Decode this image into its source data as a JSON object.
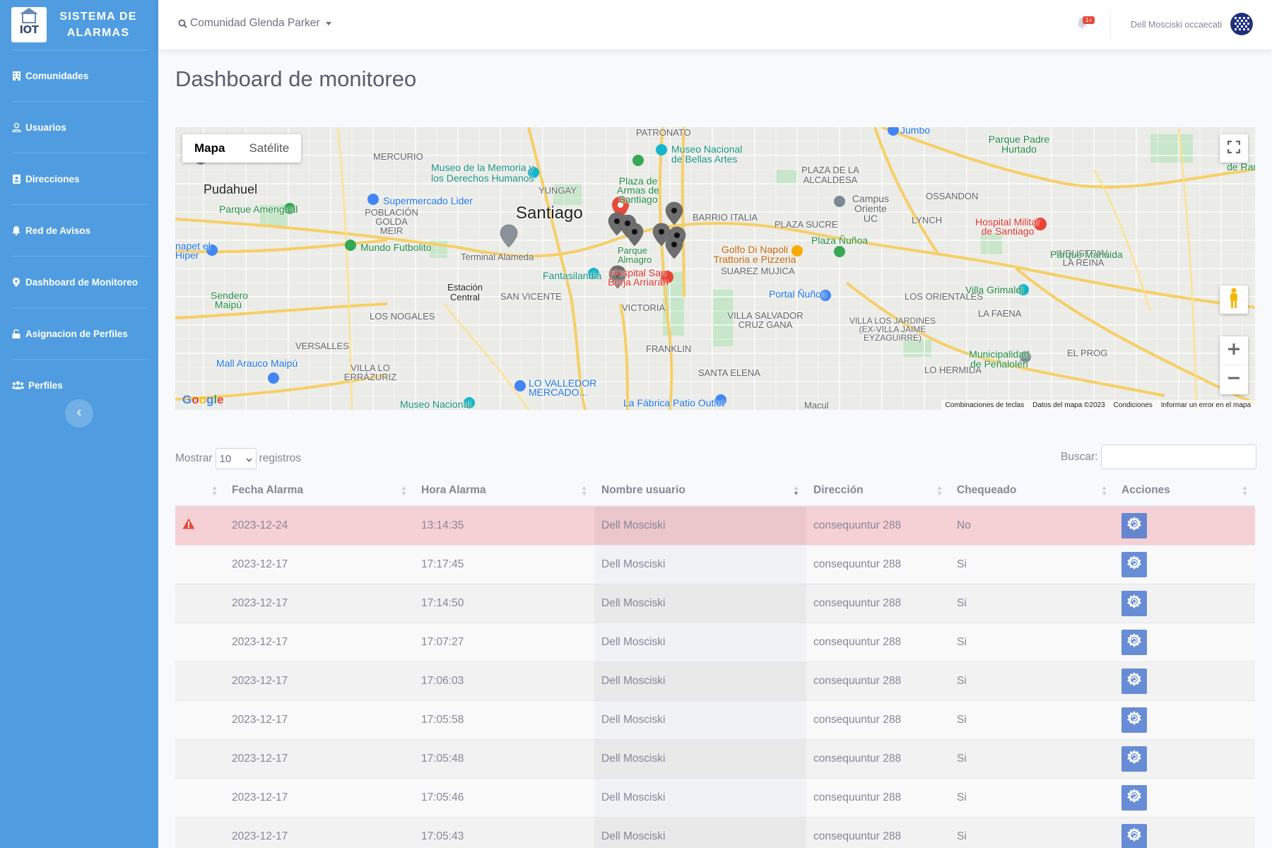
{
  "brand": {
    "logo_text": "IOT",
    "title": "SISTEMA DE ALARMAS"
  },
  "sidebar": {
    "items": [
      {
        "label": "Comunidades",
        "icon": "building-icon"
      },
      {
        "label": "Usuarios",
        "icon": "user-icon"
      },
      {
        "label": "Direcciones",
        "icon": "address-card-icon"
      },
      {
        "label": "Red de Avisos",
        "icon": "bell-icon"
      },
      {
        "label": "Dashboard de Monitoreo",
        "icon": "map-marker-icon"
      },
      {
        "label": "Asignacion de Perfiles",
        "icon": "unlock-icon"
      },
      {
        "label": "Perfiles",
        "icon": "users-icon"
      }
    ]
  },
  "topbar": {
    "community": "Comunidad Glenda Parker",
    "alerts_badge": "1+",
    "user_name": "Dell Mosciski occaecati"
  },
  "page": {
    "title": "Dashboard de monitoreo"
  },
  "map": {
    "type_map": "Mapa",
    "type_satellite": "Satélite",
    "provider": "Google",
    "labels": {
      "santiago": "Santiago",
      "pudahuel": "Pudahuel",
      "mercurio": "MERCURIO",
      "poblacion": "POBLACIÓN GOLDA MEIR",
      "yungay": "YUNGAY",
      "barrio_italia": "BARRIO ITALIA",
      "plaza_alcaldesa": "PLAZA DE LA ALCALDESA",
      "ossandon": "OSSANDON",
      "lynch": "LYNCH",
      "plaza_sucre": "PLAZA SUCRE",
      "suarez": "SUAREZ MUJICA",
      "los_orientales": "LOS ORIENTALES",
      "la_faena": "LA FAENA",
      "villa_salvador": "VILLA SALVADOR CRUZ GANA",
      "villa_los_jardines": "VILLA LOS JARDINES (EX-VILLA JAIME EYZAGUIRRE)",
      "lo_hermida": "LO HERMIDA",
      "el_proq": "EL PROG",
      "san_vicente": "SAN VICENTE",
      "los_nogales": "LOS NOGALES",
      "versalles": "VERSALLES",
      "villa_lo_errazuriz": "VILLA LO ERRÁZURIZ",
      "victoria": "VICTORIA",
      "franklin": "FRANKLIN",
      "santa_elena": "SANTA ELENA",
      "industrial": "INDUSTRIAL LA REINA",
      "patronato": "PATRONATO",
      "estacion": "Estación Central",
      "terminal": "Terminal Alameda",
      "museo_memoria": "Museo de la Memoria y los Derechos Humanos",
      "museo_bellas": "Museo Nacional de Bellas Artes",
      "plaza_armas": "Plaza de Armas de Santiago",
      "supermercado": "Supermercado Lider",
      "mundo_futbolito": "Mundo Futbolito",
      "parque_amengual": "Parque Amengual",
      "fantasilandia": "Fantasilandia",
      "hospital_san_borja": "Hospital San Borja Arriarán",
      "golfo": "Golfo Di Napoli Trattoria e Pizzeria",
      "campus": "Campus Oriente UC",
      "plaza_nunoa": "Plaza Ñuñoa",
      "portal_nunoa": "Portal Ñuñoa",
      "hospital_militar": "Hospital Militar de Santiago",
      "parque_padre": "Parque Padre Hurtado",
      "parque_mahuida": "Parque Mahuida",
      "villa_grimaldi": "Villa Grimaldi",
      "municipalidad": "Municipalidad de Peñalolén",
      "mall_arauco": "Mall Arauco Maipú",
      "sendero": "Sendero Maipú",
      "lo_valledor": "LO VALLEDOR MERCADO...",
      "museo_nacional": "Museo Nacional",
      "fabrica": "La Fábrica Patio Outlet",
      "jumbo": "Jumbo",
      "parque_almagro": "Parque Almagro",
      "hiper": "napet el Hiper",
      "macul": "Macul",
      "de_ram": "de Ram"
    },
    "footer": {
      "shortcuts": "Combinaciones de teclas",
      "data": "Datos del mapa ©2023",
      "terms": "Condiciones",
      "report": "Informar un error en el mapa"
    }
  },
  "table_controls": {
    "show_label": "Mostrar",
    "page_length": "10",
    "records_label": "registros",
    "search_label": "Buscar:"
  },
  "table": {
    "columns": [
      "",
      "Fecha Alarma",
      "Hora Alarma",
      "Nombre usuario",
      "Dirección",
      "Chequeado",
      "Acciones"
    ],
    "rows": [
      {
        "alert": true,
        "fecha": "2023-12-24",
        "hora": "13:14:35",
        "nombre": "Dell Mosciski",
        "direccion": "consequuntur 288",
        "chequeado": "No"
      },
      {
        "alert": false,
        "fecha": "2023-12-17",
        "hora": "17:17:45",
        "nombre": "Dell Mosciski",
        "direccion": "consequuntur 288",
        "chequeado": "Si"
      },
      {
        "alert": false,
        "fecha": "2023-12-17",
        "hora": "17:14:50",
        "nombre": "Dell Mosciski",
        "direccion": "consequuntur 288",
        "chequeado": "Si"
      },
      {
        "alert": false,
        "fecha": "2023-12-17",
        "hora": "17:07:27",
        "nombre": "Dell Mosciski",
        "direccion": "consequuntur 288",
        "chequeado": "Si"
      },
      {
        "alert": false,
        "fecha": "2023-12-17",
        "hora": "17:06:03",
        "nombre": "Dell Mosciski",
        "direccion": "consequuntur 288",
        "chequeado": "Si"
      },
      {
        "alert": false,
        "fecha": "2023-12-17",
        "hora": "17:05:58",
        "nombre": "Dell Mosciski",
        "direccion": "consequuntur 288",
        "chequeado": "Si"
      },
      {
        "alert": false,
        "fecha": "2023-12-17",
        "hora": "17:05:48",
        "nombre": "Dell Mosciski",
        "direccion": "consequuntur 288",
        "chequeado": "Si"
      },
      {
        "alert": false,
        "fecha": "2023-12-17",
        "hora": "17:05:46",
        "nombre": "Dell Mosciski",
        "direccion": "consequuntur 288",
        "chequeado": "Si"
      },
      {
        "alert": false,
        "fecha": "2023-12-17",
        "hora": "17:05:43",
        "nombre": "Dell Mosciski",
        "direccion": "consequuntur 288",
        "chequeado": "Si"
      }
    ]
  },
  "colors": {
    "sidebar": "#4f9de0",
    "alert_row": "#f5d0d5",
    "action_button": "#4e7bd0",
    "alert_icon": "#e74a3b"
  }
}
